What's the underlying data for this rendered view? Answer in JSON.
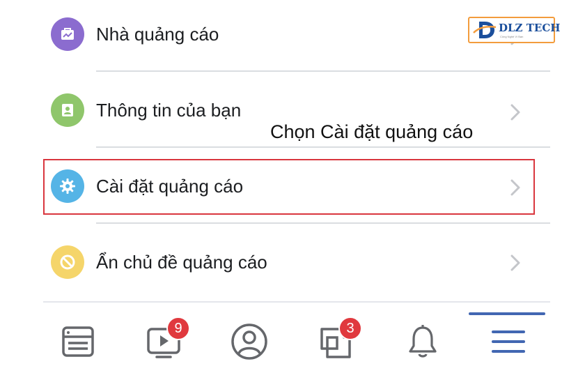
{
  "menu": {
    "items": [
      {
        "label": "Nhà quảng cáo",
        "icon": "advertiser-icon",
        "color": "#8b6ccf"
      },
      {
        "label": "Thông tin của bạn",
        "icon": "your-info-icon",
        "color": "#8fc66b"
      },
      {
        "label": "Cài đặt quảng cáo",
        "icon": "gear-icon",
        "color": "#55b4e6"
      },
      {
        "label": "Ẩn chủ đề quảng cáo",
        "icon": "hide-topic-icon",
        "color": "#f5d56a"
      }
    ]
  },
  "annotation": "Chọn Cài đặt quảng cáo",
  "logo": {
    "text": "DLZ TECH",
    "tagline": "Công Nghệ Vì Bạn"
  },
  "tabbar": {
    "tabs": [
      {
        "icon": "news-feed-icon"
      },
      {
        "icon": "watch-icon",
        "badge": "9"
      },
      {
        "icon": "profile-icon"
      },
      {
        "icon": "pages-icon",
        "badge": "3"
      },
      {
        "icon": "notifications-icon"
      },
      {
        "icon": "menu-icon",
        "active": true
      }
    ]
  },
  "colors": {
    "highlight": "#d9363e",
    "badge": "#e0393e",
    "active": "#4267b2",
    "icon_gray": "#65676b"
  }
}
